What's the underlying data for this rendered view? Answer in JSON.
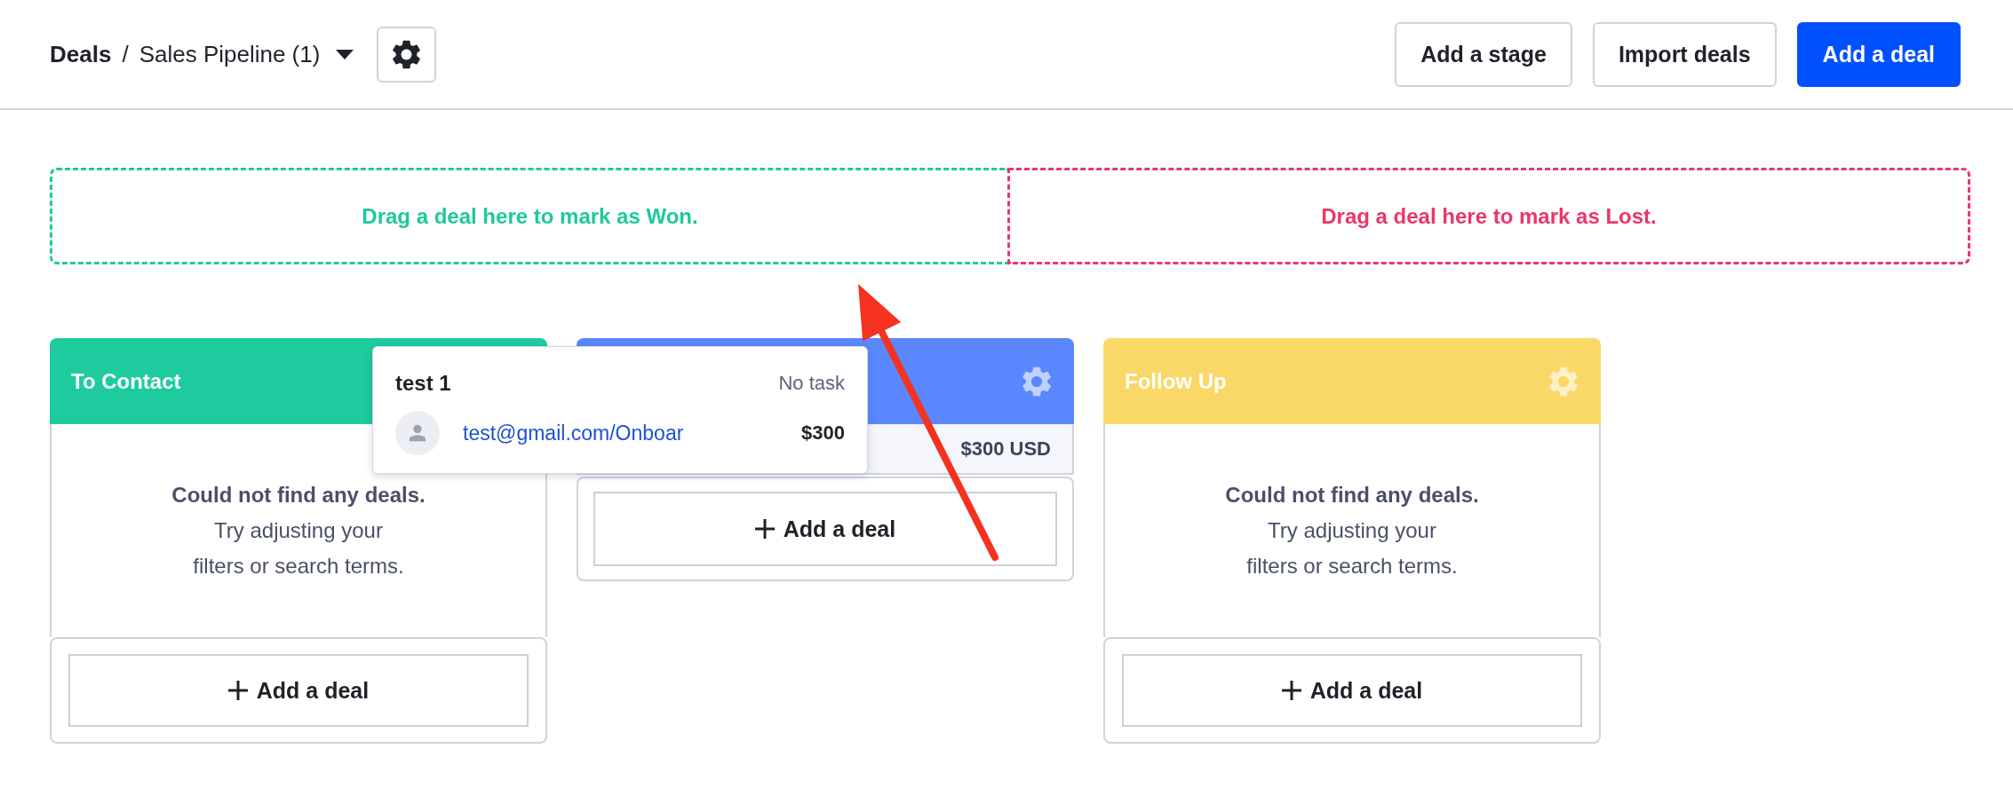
{
  "breadcrumb": {
    "root": "Deals",
    "separator": "/",
    "current": "Sales Pipeline (1)"
  },
  "header_actions": [
    {
      "label": "Add a stage",
      "kind": "secondary"
    },
    {
      "label": "Import deals",
      "kind": "secondary"
    },
    {
      "label": "Add a deal",
      "kind": "primary"
    }
  ],
  "drop_zones": [
    {
      "kind": "won",
      "text": "Drag a deal here to mark as Won."
    },
    {
      "kind": "lost",
      "text": "Drag a deal here to mark as Lost."
    }
  ],
  "columns": [
    {
      "title": "To Contact",
      "color": "#1dcb9f",
      "settings_icon": false,
      "empty_state": {
        "title": "Could not find any deals.",
        "hint": "Try adjusting your filters or search terms."
      },
      "add_button": "Add a deal"
    },
    {
      "color": "#5a87fd",
      "settings_icon": true,
      "summary": "$300 USD",
      "add_button": "Add a deal"
    },
    {
      "title": "Follow Up",
      "color": "#f9d867",
      "settings_icon": true,
      "empty_state": {
        "title": "Could not find any deals.",
        "hint": "Try adjusting your filters or search terms."
      },
      "add_button": "Add a deal"
    }
  ],
  "dragged_deal": {
    "title": "test 1",
    "task": "No task",
    "contact": "test@gmail.com/Onboar",
    "value": "$300"
  }
}
